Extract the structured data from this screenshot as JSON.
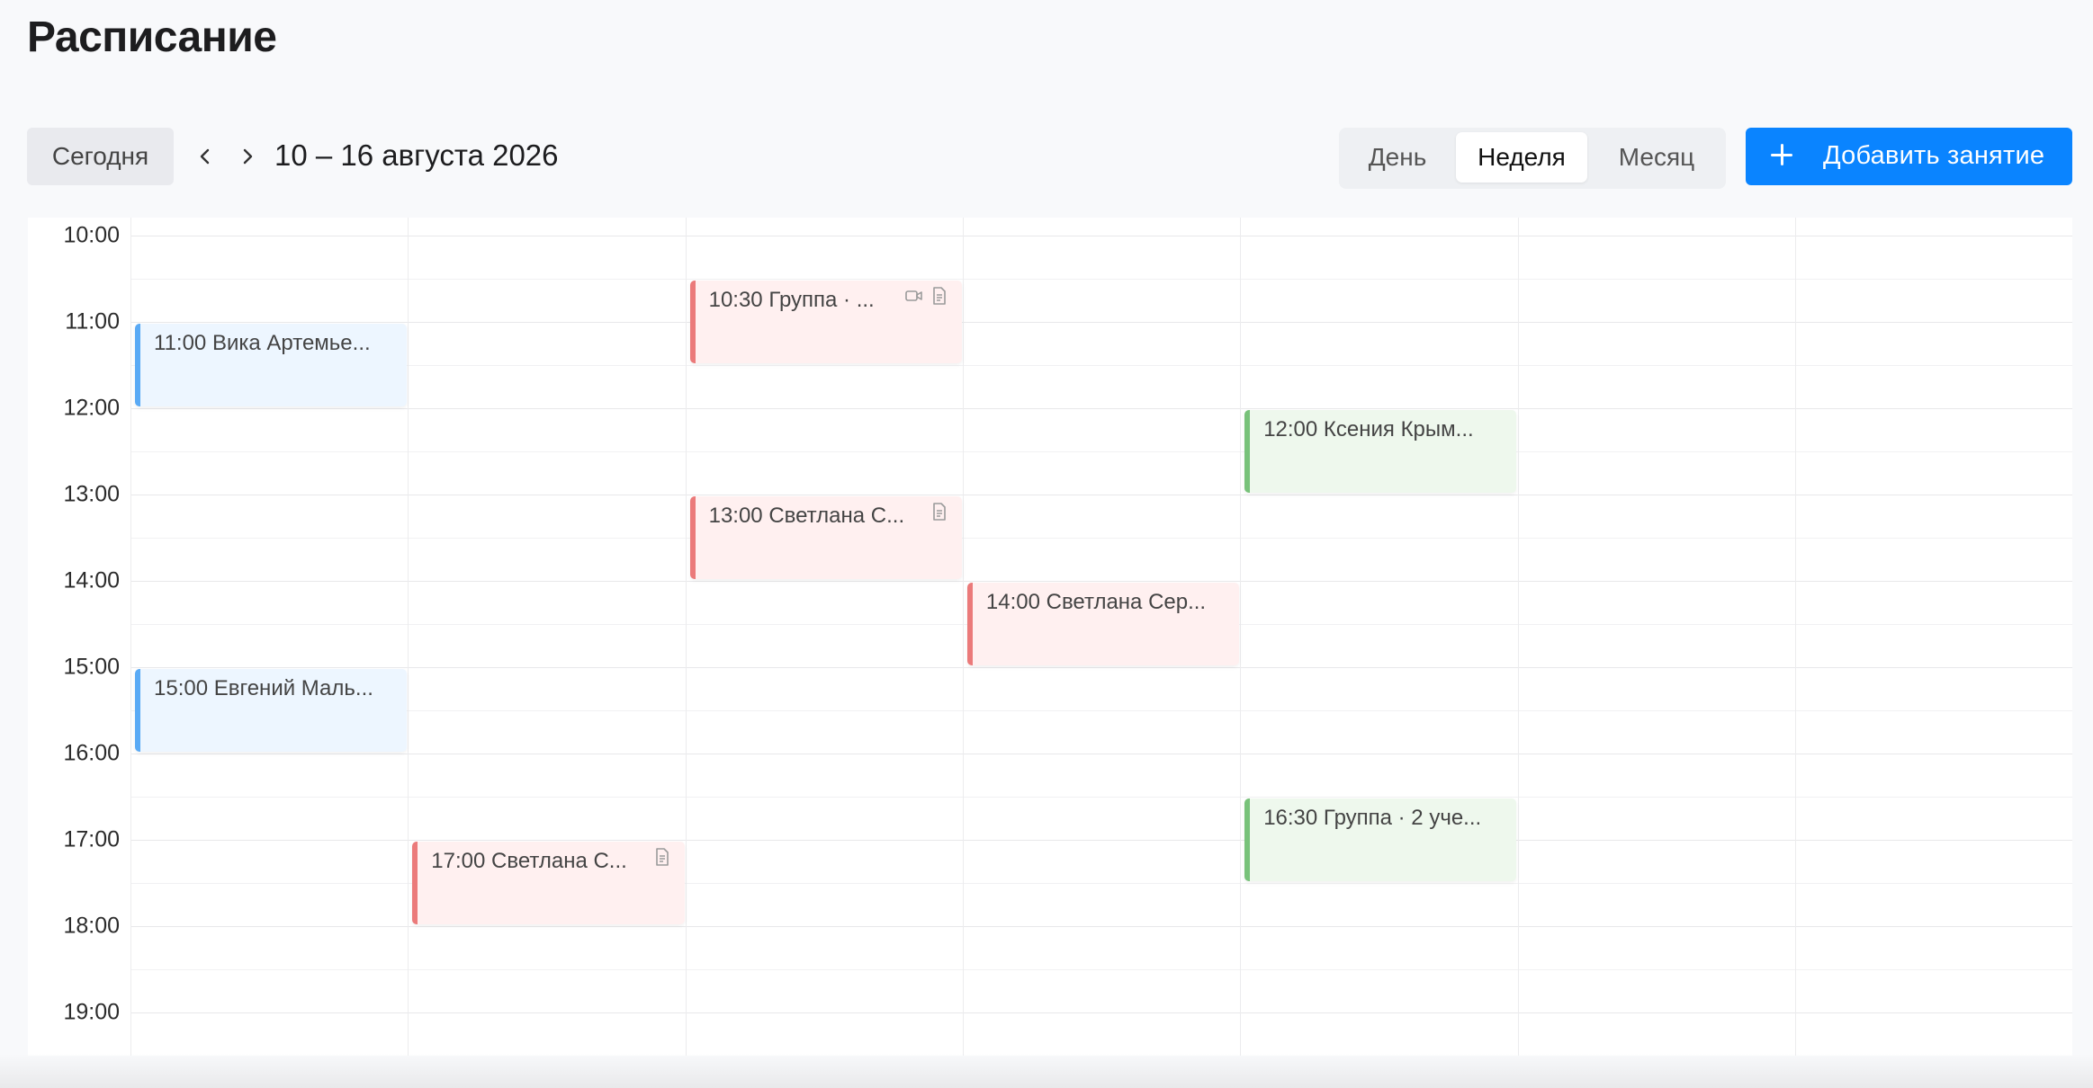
{
  "page": {
    "title": "Расписание"
  },
  "toolbar": {
    "today_label": "Сегодня",
    "prev_icon": "chevron-left-icon",
    "next_icon": "chevron-right-icon",
    "date_range": "10 – 16 августа 2026",
    "views": [
      {
        "label": "День",
        "active": false
      },
      {
        "label": "Неделя",
        "active": true
      },
      {
        "label": "Месяц",
        "active": false
      }
    ],
    "add_label": "Добавить занятие",
    "add_icon": "plus-icon"
  },
  "calendar": {
    "hours": [
      "10:00",
      "11:00",
      "12:00",
      "13:00",
      "14:00",
      "15:00",
      "16:00",
      "17:00",
      "18:00",
      "19:00"
    ],
    "events": [
      {
        "title": "11:00 Вика Артемье...",
        "color": "blue",
        "day": 0,
        "start": 11.0,
        "end": 12.0,
        "icons": []
      },
      {
        "title": "10:30 Группа · ...",
        "color": "red",
        "day": 2,
        "start": 10.5,
        "end": 11.5,
        "icons": [
          "video-icon",
          "document-icon"
        ]
      },
      {
        "title": "12:00 Ксения Крым...",
        "color": "green",
        "day": 4,
        "start": 12.0,
        "end": 13.0,
        "icons": []
      },
      {
        "title": "13:00 Светлана С...",
        "color": "red",
        "day": 2,
        "start": 13.0,
        "end": 14.0,
        "icons": [
          "document-icon"
        ]
      },
      {
        "title": "14:00 Светлана Сер...",
        "color": "red",
        "day": 3,
        "start": 14.0,
        "end": 15.0,
        "icons": []
      },
      {
        "title": "15:00 Евгений Маль...",
        "color": "blue",
        "day": 0,
        "start": 15.0,
        "end": 16.0,
        "icons": []
      },
      {
        "title": "16:30 Группа · 2 уче...",
        "color": "green",
        "day": 4,
        "start": 16.5,
        "end": 17.5,
        "icons": []
      },
      {
        "title": "17:00 Светлана С...",
        "color": "red",
        "day": 1,
        "start": 17.0,
        "end": 18.0,
        "icons": [
          "document-icon"
        ]
      }
    ]
  },
  "colors": {
    "accent": "#0a84ff",
    "event_blue": "#5aaaf5",
    "event_red": "#eb7a7a",
    "event_green": "#78c27a"
  }
}
